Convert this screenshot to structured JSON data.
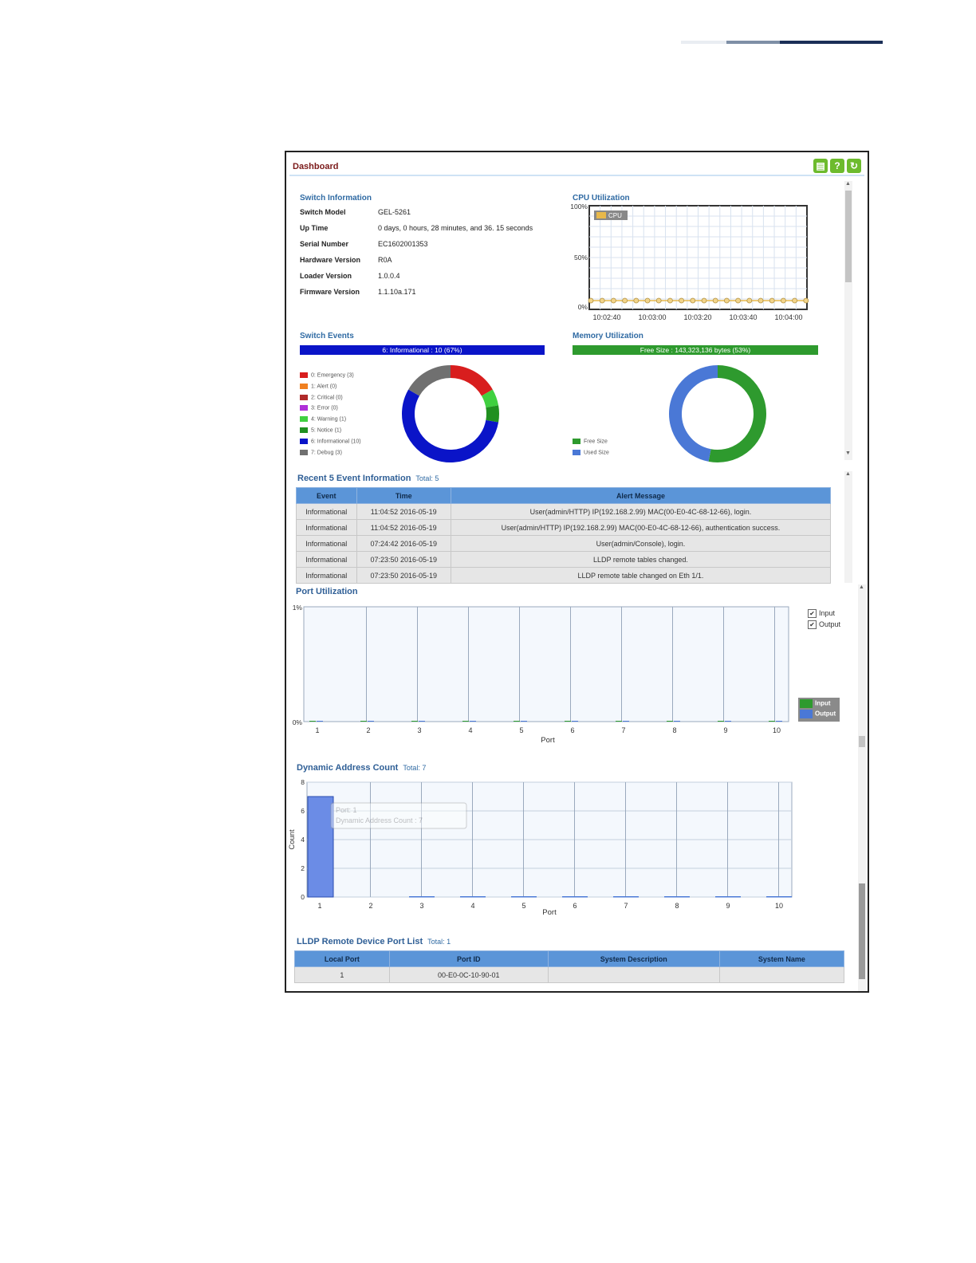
{
  "page_decoration": {
    "colors": [
      "#e9edf2",
      "#7e8fa6",
      "#1b2f57"
    ]
  },
  "dashboard": {
    "title": "Dashboard",
    "toolbar": [
      {
        "icon": "save-icon",
        "glyph": "▤",
        "color": "#6dbb2d"
      },
      {
        "icon": "help-icon",
        "glyph": "?",
        "color": "#6dbb2d"
      },
      {
        "icon": "refresh-icon",
        "glyph": "↻",
        "color": "#6dbb2d"
      }
    ]
  },
  "switch_info": {
    "title": "Switch Information",
    "rows": [
      {
        "label": "Switch Model",
        "value": "GEL-5261"
      },
      {
        "label": "Up Time",
        "value": "0 days, 0 hours, 28 minutes, and 36. 15 seconds"
      },
      {
        "label": "Serial Number",
        "value": "EC1602001353"
      },
      {
        "label": "Hardware Version",
        "value": "R0A"
      },
      {
        "label": "Loader Version",
        "value": "1.0.0.4"
      },
      {
        "label": "Firmware Version",
        "value": "1.1.10a.171"
      }
    ]
  },
  "cpu": {
    "title": "CPU Utilization",
    "legend": "CPU",
    "y_ticks": [
      "100%",
      "50%",
      "0%"
    ],
    "x_ticks": [
      "10:02:40",
      "10:03:00",
      "10:03:20",
      "10:03:40",
      "10:04:00"
    ],
    "color": "#e8b84a"
  },
  "switch_events": {
    "title": "Switch Events",
    "bar_label": "6: Informational : 10 (67%)",
    "bar_color": "#0a14c8",
    "legend": [
      {
        "label": "0: Emergency (3)",
        "color": "#d81e1e"
      },
      {
        "label": "1: Alert (0)",
        "color": "#f08020"
      },
      {
        "label": "2: Critical (0)",
        "color": "#b02a2a"
      },
      {
        "label": "3: Error (0)",
        "color": "#b030d8"
      },
      {
        "label": "4: Warning (1)",
        "color": "#40d040"
      },
      {
        "label": "5: Notice (1)",
        "color": "#209020"
      },
      {
        "label": "6: Informational (10)",
        "color": "#0a14c8"
      },
      {
        "label": "7: Debug (3)",
        "color": "#707070"
      }
    ]
  },
  "memory": {
    "title": "Memory Utilization",
    "bar_label": "Free Size : 143,323,136 bytes (53%)",
    "bar_color": "#2e9a2e",
    "legend": [
      {
        "label": "Free Size",
        "color": "#2e9a2e"
      },
      {
        "label": "Used Size",
        "color": "#4a78d6"
      }
    ]
  },
  "recent_events": {
    "title": "Recent 5 Event Information",
    "total": "Total: 5",
    "headers": [
      "Event",
      "Time",
      "Alert Message"
    ],
    "rows": [
      [
        "Informational",
        "11:04:52 2016-05-19",
        "User(admin/HTTP) IP(192.168.2.99) MAC(00-E0-4C-68-12-66), login."
      ],
      [
        "Informational",
        "11:04:52 2016-05-19",
        "User(admin/HTTP) IP(192.168.2.99) MAC(00-E0-4C-68-12-66), authentication success."
      ],
      [
        "Informational",
        "07:24:42 2016-05-19",
        "User(admin/Console), login."
      ],
      [
        "Informational",
        "07:23:50 2016-05-19",
        "LLDP remote tables changed."
      ],
      [
        "Informational",
        "07:23:50 2016-05-19",
        "LLDP remote table changed on Eth 1/1."
      ]
    ]
  },
  "port_util": {
    "title": "Port Utilization",
    "y_ticks": [
      "1%",
      "0%"
    ],
    "xlabel": "Port",
    "checkboxes": [
      "Input",
      "Output"
    ],
    "legend": [
      {
        "label": "Input",
        "color": "#2e9a2e"
      },
      {
        "label": "Output",
        "color": "#4a78d6"
      }
    ]
  },
  "dynamic_address": {
    "title": "Dynamic Address Count",
    "total": "Total: 7",
    "ylabel": "Count",
    "xlabel": "Port",
    "tooltip": [
      "Port: 1",
      "Dynamic Address Count : 7"
    ]
  },
  "lldp": {
    "title": "LLDP Remote Device Port List",
    "total": "Total: 1",
    "headers": [
      "Local Port",
      "Port ID",
      "System Description",
      "System Name"
    ],
    "rows": [
      [
        "1",
        "00-E0-0C-10-90-01",
        "",
        ""
      ]
    ]
  },
  "chart_data": [
    {
      "type": "line",
      "title": "CPU Utilization",
      "x": [
        "10:02:40",
        "10:03:00",
        "10:03:20",
        "10:03:40",
        "10:04:00"
      ],
      "series": [
        {
          "name": "CPU",
          "values": [
            0,
            0,
            0,
            0,
            0
          ]
        }
      ],
      "ylim": [
        0,
        100
      ],
      "y_unit": "%"
    },
    {
      "type": "pie",
      "title": "Switch Events",
      "categories": [
        "0: Emergency",
        "1: Alert",
        "2: Critical",
        "3: Error",
        "4: Warning",
        "5: Notice",
        "6: Informational",
        "7: Debug"
      ],
      "values": [
        3,
        0,
        0,
        0,
        1,
        1,
        10,
        3
      ]
    },
    {
      "type": "pie",
      "title": "Memory Utilization",
      "categories": [
        "Free Size",
        "Used Size"
      ],
      "values": [
        53,
        47
      ]
    },
    {
      "type": "bar",
      "title": "Port Utilization",
      "categories": [
        "1",
        "2",
        "3",
        "4",
        "5",
        "6",
        "7",
        "8",
        "9",
        "10"
      ],
      "series": [
        {
          "name": "Input",
          "values": [
            0,
            0,
            0,
            0,
            0,
            0,
            0,
            0,
            0,
            0
          ]
        },
        {
          "name": "Output",
          "values": [
            0,
            0,
            0,
            0,
            0,
            0,
            0,
            0,
            0,
            0
          ]
        }
      ],
      "xlabel": "Port",
      "ylim": [
        0,
        1
      ],
      "y_unit": "%"
    },
    {
      "type": "bar",
      "title": "Dynamic Address Count",
      "categories": [
        "1",
        "2",
        "3",
        "4",
        "5",
        "6",
        "7",
        "8",
        "9",
        "10"
      ],
      "values": [
        7,
        0,
        0,
        0,
        0,
        0,
        0,
        0,
        0,
        0
      ],
      "xlabel": "Port",
      "ylabel": "Count",
      "ylim": [
        0,
        8
      ],
      "y_ticks": [
        0,
        2,
        4,
        6,
        8
      ]
    }
  ]
}
